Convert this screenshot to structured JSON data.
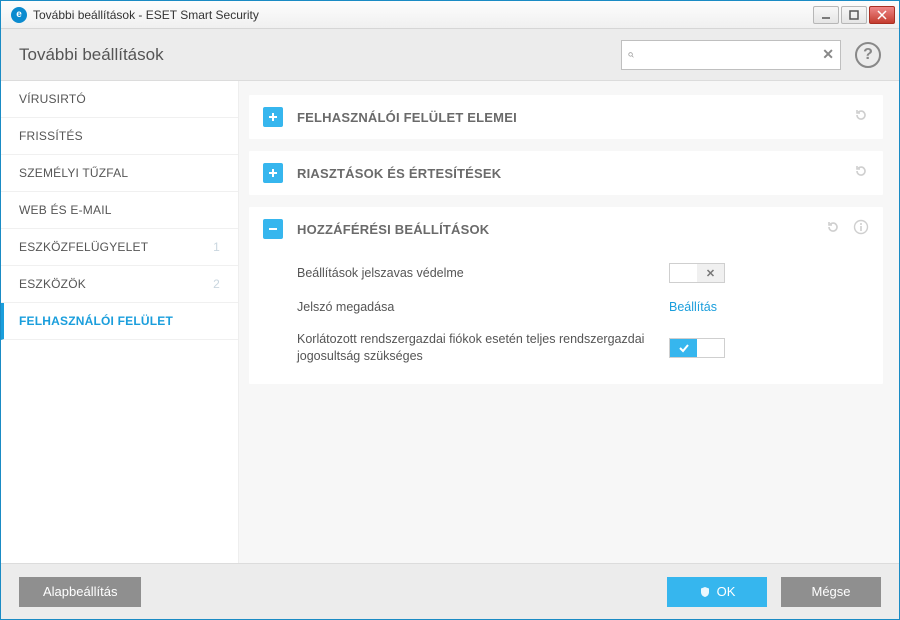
{
  "window": {
    "title": "További beállítások - ESET Smart Security"
  },
  "header": {
    "title": "További beállítások",
    "search_placeholder": ""
  },
  "sidebar": {
    "items": [
      {
        "label": "VÍRUSIRTÓ",
        "badge": ""
      },
      {
        "label": "FRISSÍTÉS",
        "badge": ""
      },
      {
        "label": "SZEMÉLYI TŰZFAL",
        "badge": ""
      },
      {
        "label": "WEB ÉS E-MAIL",
        "badge": ""
      },
      {
        "label": "ESZKÖZFELÜGYELET",
        "badge": "1"
      },
      {
        "label": "ESZKÖZÖK",
        "badge": "2"
      },
      {
        "label": "FELHASZNÁLÓI FELÜLET",
        "badge": ""
      }
    ]
  },
  "panels": [
    {
      "title": "FELHASZNÁLÓI FELÜLET ELEMEI",
      "expanded": false
    },
    {
      "title": "RIASZTÁSOK ÉS ÉRTESÍTÉSEK",
      "expanded": false
    },
    {
      "title": "HOZZÁFÉRÉSI BEÁLLÍTÁSOK",
      "expanded": true,
      "rows": [
        {
          "label": "Beállítások jelszavas védelme",
          "type": "switch",
          "on": false
        },
        {
          "label": "Jelszó megadása",
          "type": "link",
          "link": "Beállítás"
        },
        {
          "label": "Korlátozott rendszergazdai fiókok esetén teljes rendszergazdai jogosultság szükséges",
          "type": "switch",
          "on": true
        }
      ]
    }
  ],
  "footer": {
    "default": "Alapbeállítás",
    "ok": "OK",
    "cancel": "Mégse"
  }
}
